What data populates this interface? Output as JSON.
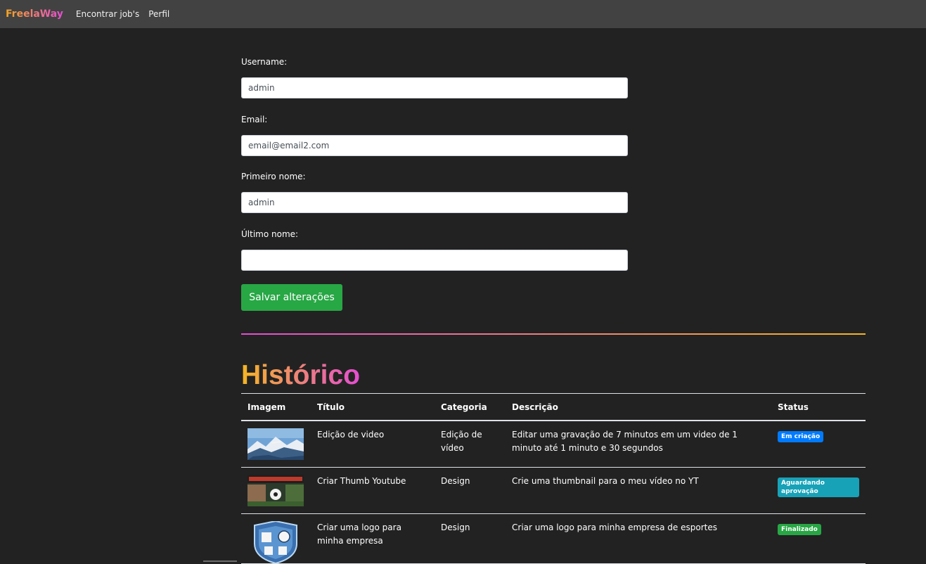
{
  "nav": {
    "brand": "FreelaWay",
    "links": [
      "Encontrar job's",
      "Perfil"
    ]
  },
  "form": {
    "username_label": "Username:",
    "username_value": "admin",
    "email_label": "Email:",
    "email_value": "email@email2.com",
    "first_name_label": "Primeiro nome:",
    "first_name_value": "admin",
    "last_name_label": "Último nome:",
    "last_name_value": "",
    "save_label": "Salvar alterações"
  },
  "history": {
    "title": "Histórico",
    "columns": [
      "Imagem",
      "Título",
      "Categoria",
      "Descrição",
      "Status"
    ],
    "rows": [
      {
        "image": "mountain-plane-thumbnail",
        "title": "Edição de video",
        "category": "Edição de vídeo",
        "description": "Editar uma gravação de 7 minutos em um video de 1 minuto até 1 minuto e 30 segundos",
        "status": "Em criação",
        "status_color": "#007bff"
      },
      {
        "image": "politica-futebol-thumbnail",
        "title": "Criar Thumb Youtube",
        "category": "Design",
        "description": "Crie uma thumbnail para o meu vídeo no YT",
        "status": "Aguardando aprovação",
        "status_color": "#17a2b8"
      },
      {
        "image": "sports-shield-logo",
        "title": "Criar uma logo para minha empresa",
        "category": "Design",
        "description": "Criar uma logo para minha empresa de esportes",
        "status": "Finalizado",
        "status_color": "#28a745"
      }
    ]
  },
  "colors": {
    "background": "#222222",
    "navbar": "#424242",
    "accent_gradient_start": "#f5b623",
    "accent_gradient_end": "#e44dd3",
    "save_button": "#28a745"
  }
}
